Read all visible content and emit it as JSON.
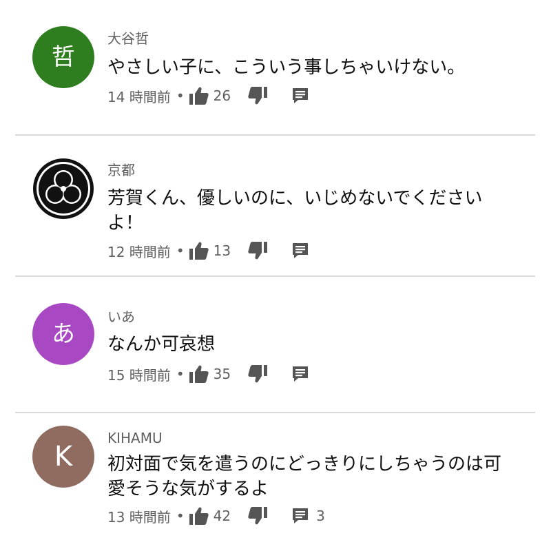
{
  "colors": {
    "avatar_1": "#2e7d1f",
    "avatar_3": "#a848c2",
    "avatar_4": "#8f6b60",
    "meta_text": "#606060",
    "icon": "#555555"
  },
  "comments": [
    {
      "author": "大谷哲",
      "avatar_char": "哲",
      "text": "やさしい子に、こういう事しちゃいけない。",
      "time": "14 時間前",
      "separator": "•",
      "likes": "26",
      "icons": [
        "thumb-up-icon",
        "thumb-down-icon",
        "comment-icon"
      ]
    },
    {
      "author": "京都",
      "avatar_char": "",
      "text": "芳賀くん、優しいのに、いじめないでくださいよ！",
      "time": "12 時間前",
      "separator": "•",
      "likes": "13",
      "icons": [
        "thumb-up-icon",
        "thumb-down-icon",
        "comment-icon"
      ]
    },
    {
      "author": "いあ",
      "avatar_char": "あ",
      "text": "なんか可哀想",
      "time": "15 時間前",
      "separator": "•",
      "likes": "35",
      "icons": [
        "thumb-up-icon",
        "thumb-down-icon",
        "comment-icon"
      ]
    },
    {
      "author": "KIHAMU",
      "avatar_char": "K",
      "text": "初対面で気を遣うのにどっきりにしちゃうのは可愛そうな気がするよ",
      "time": "13 時間前",
      "separator": "•",
      "likes": "42",
      "replies": "3",
      "icons": [
        "thumb-up-icon",
        "thumb-down-icon",
        "comment-icon"
      ]
    }
  ]
}
